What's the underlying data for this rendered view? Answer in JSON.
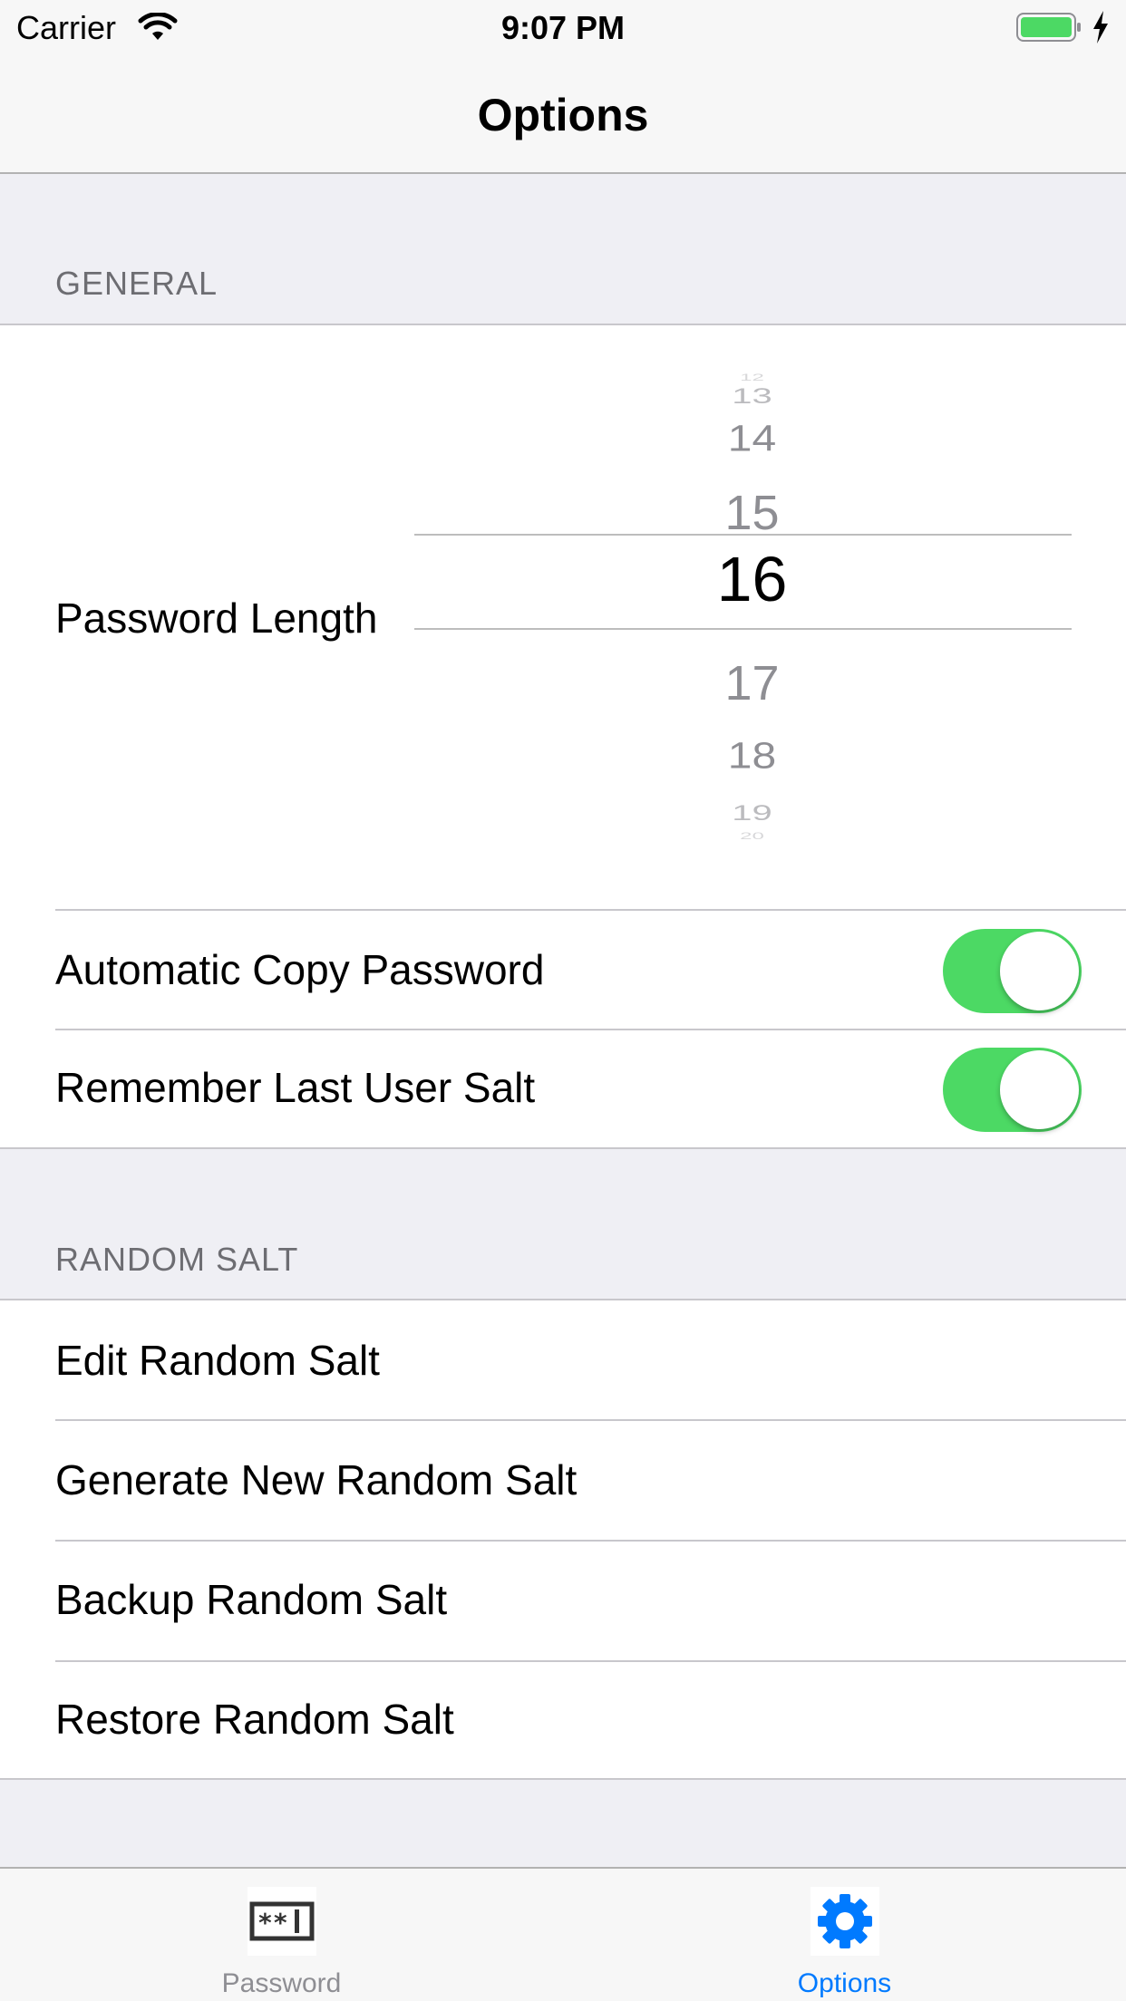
{
  "status_bar": {
    "carrier": "Carrier",
    "time": "9:07 PM",
    "battery_color": "#4cd964"
  },
  "nav": {
    "title": "Options"
  },
  "general": {
    "header": "GENERAL",
    "password_length": {
      "label": "Password Length",
      "selected": "16",
      "above": [
        "12",
        "13",
        "14",
        "15"
      ],
      "below": [
        "17",
        "18",
        "19",
        "20"
      ]
    },
    "auto_copy": {
      "label": "Automatic Copy Password",
      "on": true
    },
    "remember_salt": {
      "label": "Remember Last User Salt",
      "on": true
    }
  },
  "random_salt": {
    "header": "RANDOM SALT",
    "items": [
      {
        "label": "Edit Random Salt"
      },
      {
        "label": "Generate New Random Salt"
      },
      {
        "label": "Backup Random Salt"
      },
      {
        "label": "Restore Random Salt"
      }
    ]
  },
  "tabs": [
    {
      "label": "Password",
      "icon": "password-field-icon",
      "active": false,
      "color": "#8e8e93"
    },
    {
      "label": "Options",
      "icon": "gear-icon",
      "active": true,
      "color": "#007aff"
    }
  ]
}
